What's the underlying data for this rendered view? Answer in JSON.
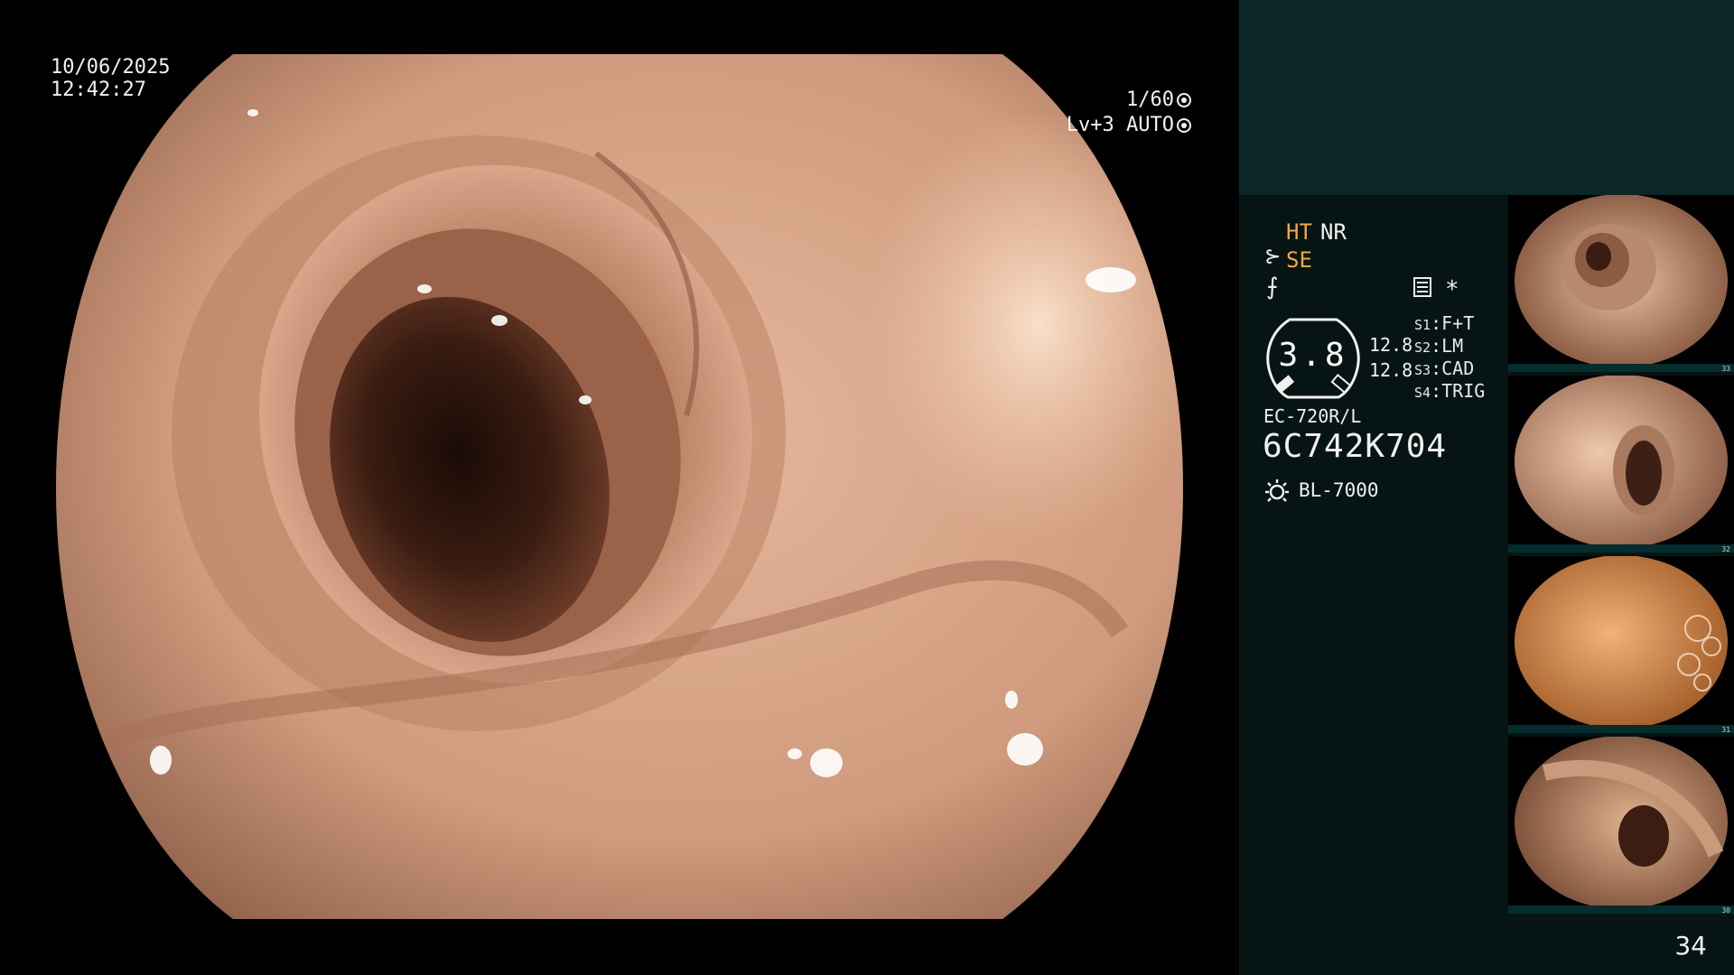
{
  "overlay": {
    "date": "10/06/2025",
    "time": "12:42:27",
    "shutter": "1/60",
    "level": "Lv+3 AUTO"
  },
  "panel": {
    "ht": "HT",
    "nr": "NR",
    "se": "SE",
    "gauge_value": "3.8",
    "value_1": "12.8",
    "value_2": "12.8",
    "switches": [
      {
        "key": "S1",
        "value": "F+T"
      },
      {
        "key": "S2",
        "value": "LM"
      },
      {
        "key": "S3",
        "value": "CAD"
      },
      {
        "key": "S4",
        "value": "TRIG"
      }
    ],
    "scope_model": "EC-720R/L",
    "scope_serial": "6C742K704",
    "light_source": "BL-7000",
    "accent_color": "#f3a83b"
  },
  "thumbnails": [
    {
      "number": "33"
    },
    {
      "number": "32"
    },
    {
      "number": "31"
    },
    {
      "number": "30"
    }
  ],
  "page_number": "34"
}
